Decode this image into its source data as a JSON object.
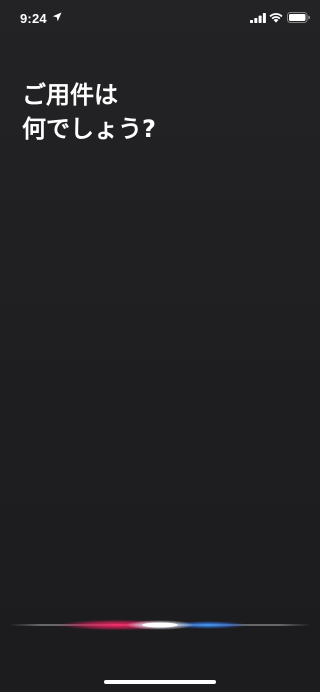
{
  "status_bar": {
    "time": "9:24",
    "icons": [
      "location-arrow-icon",
      "cellular-signal-icon",
      "wifi-icon",
      "battery-icon"
    ]
  },
  "prompt": {
    "line1": "ご用件は",
    "line2": "何でしょう?"
  },
  "siri": {
    "wave_colors": [
      "#e0245e",
      "#ffffff",
      "#3b82f6"
    ]
  },
  "colors": {
    "background": "#1f1f21",
    "text": "#ffffff"
  }
}
